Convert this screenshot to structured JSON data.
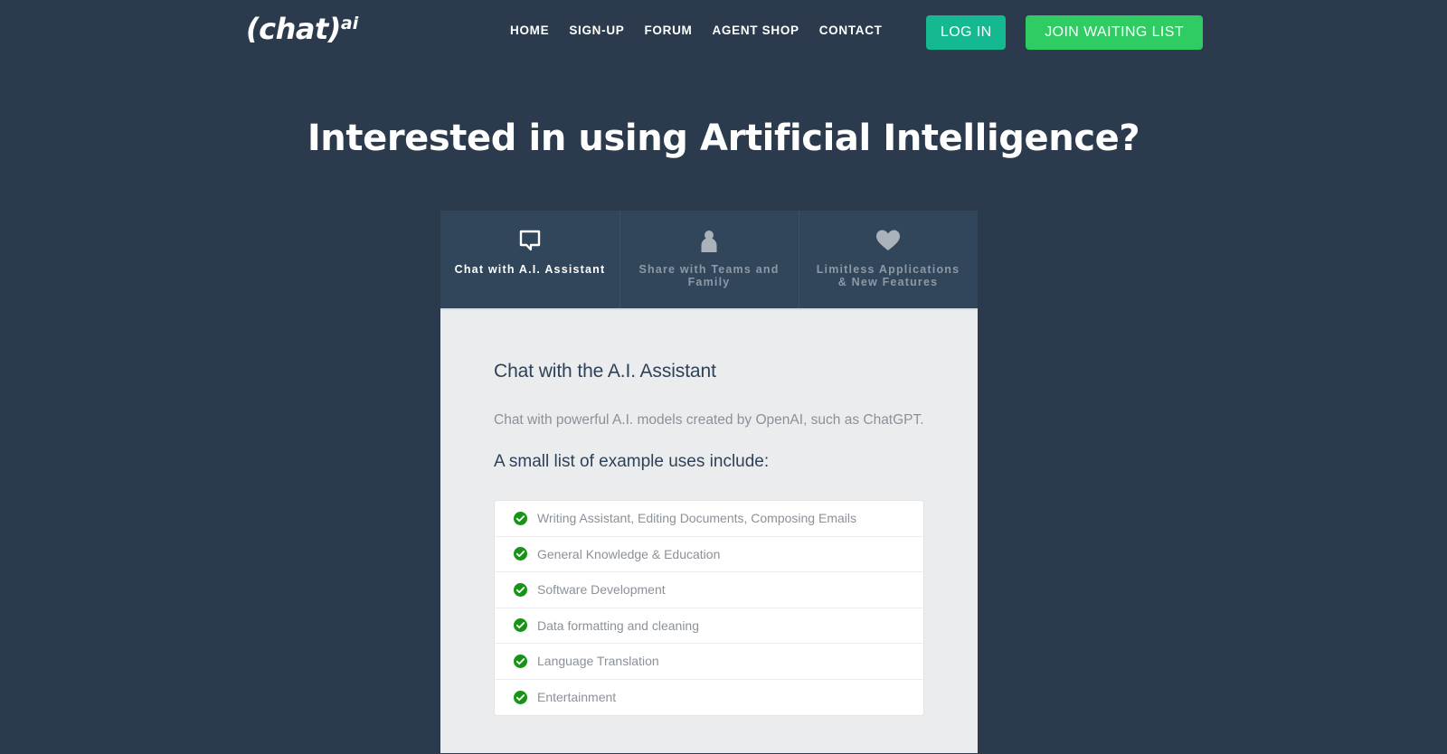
{
  "header": {
    "logo_text": "(chat)",
    "logo_sup": "ai",
    "nav": [
      {
        "label": "HOME",
        "name": "nav-home"
      },
      {
        "label": "SIGN-UP",
        "name": "nav-sign-up"
      },
      {
        "label": "FORUM",
        "name": "nav-forum"
      },
      {
        "label": "AGENT SHOP",
        "name": "nav-agent-shop"
      },
      {
        "label": "CONTACT",
        "name": "nav-contact"
      }
    ],
    "login_label": "LOG IN",
    "join_label": "JOIN WAITING LIST"
  },
  "hero": {
    "title": "Interested in using Artificial Intelligence?"
  },
  "tabs": [
    {
      "label": "Chat with A.I. Assistant",
      "icon": "speech-bubble-icon",
      "active": true
    },
    {
      "label": "Share with Teams and Family",
      "icon": "person-icon",
      "active": false
    },
    {
      "label": "Limitless Applications & New Features",
      "icon": "heart-icon",
      "active": false
    }
  ],
  "panel": {
    "title": "Chat with the A.I. Assistant",
    "description": "Chat with powerful A.I. models created by OpenAI, such as ChatGPT.",
    "list_heading": "A small list of example uses include:",
    "items": [
      "Writing Assistant, Editing Documents, Composing Emails",
      "General Knowledge & Education",
      "Software Development",
      "Data formatting and cleaning",
      "Language Translation",
      "Entertainment"
    ]
  },
  "colors": {
    "page_bg": "#2b3b4d",
    "tab_bg": "#31455b",
    "panel_bg": "#ebecee",
    "login_button": "#14b891",
    "join_button": "#2ecc62",
    "check_green": "#179417",
    "heading": "#2f4257",
    "muted_text": "#8b9199"
  }
}
